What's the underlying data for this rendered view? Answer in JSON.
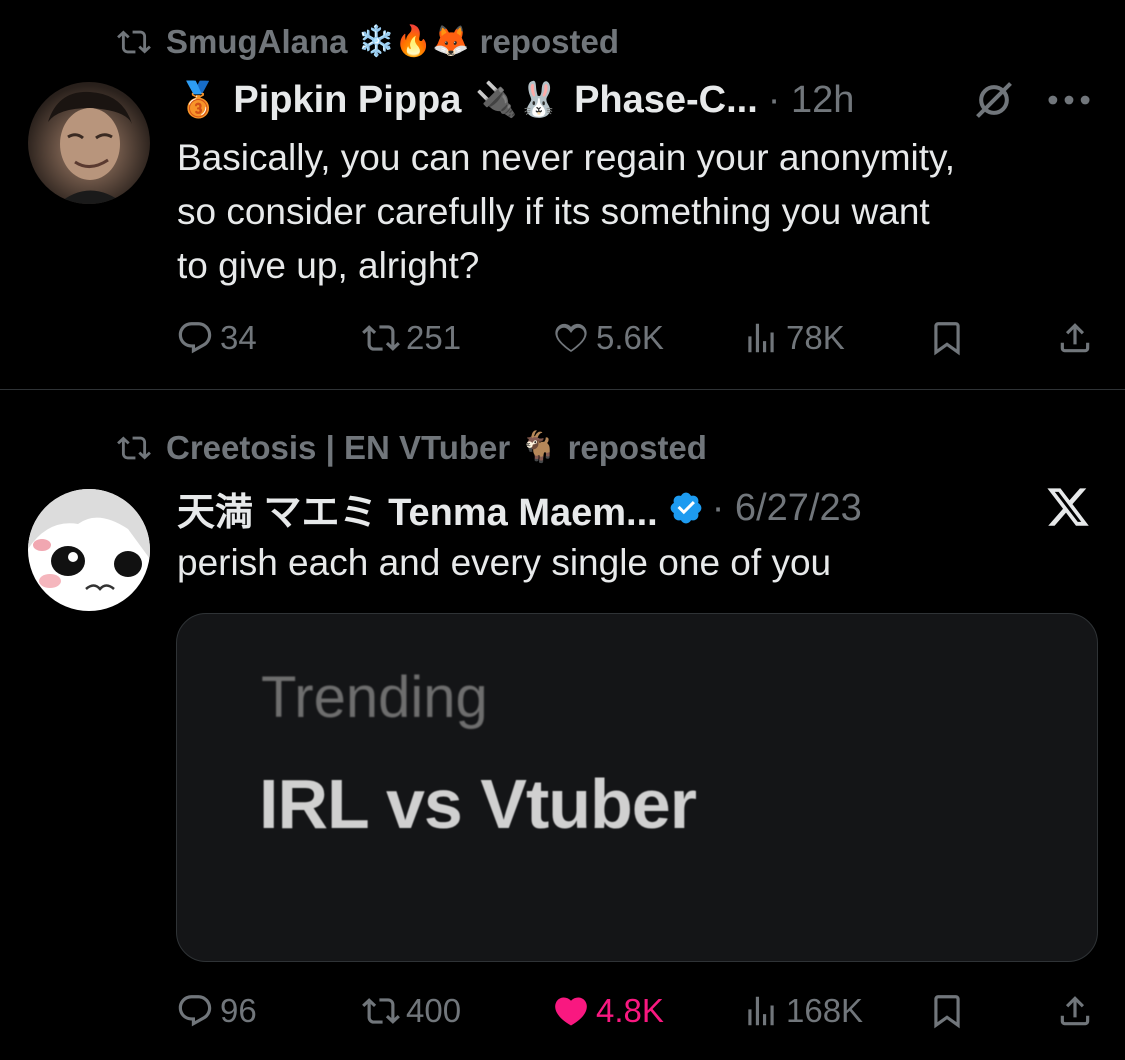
{
  "tweets": [
    {
      "repost": {
        "user": "SmugAlana",
        "emojis": "❄️🔥🦊",
        "label": "reposted"
      },
      "badge_emoji": "🥉",
      "author": "Pipkin Pippa",
      "name_emojis": "🔌🐰",
      "author_suffix": "Phase-C...",
      "time": "· 12h",
      "text_lines": [
        "Basically, you can never regain your anonymity,",
        "so consider carefully if its something you want",
        "to give up, alright?"
      ],
      "stats": {
        "replies": "34",
        "reposts": "251",
        "likes": "5.6K",
        "views": "78K"
      }
    },
    {
      "repost": {
        "user": "Creetosis | EN VTuber",
        "emojis": "🐐",
        "label": "reposted"
      },
      "author": "天満 マエミ Tenma Maem...",
      "time": "· 6/27/23",
      "text_lines": [
        "perish each and every single one of you"
      ],
      "card": {
        "small": "Trending",
        "big": "IRL vs Vtuber"
      },
      "stats": {
        "replies": "96",
        "reposts": "400",
        "likes": "4.8K",
        "views": "168K"
      }
    }
  ],
  "colors": {
    "background": "#000000",
    "text": "#e7e9ea",
    "muted": "#71767b",
    "like": "#f91880",
    "verified": "#1d9bf0"
  },
  "icons": [
    "repost-icon",
    "reply-icon",
    "like-icon",
    "views-icon",
    "bookmark-icon",
    "share-icon",
    "more-icon",
    "x-logo-icon",
    "verified-icon",
    "grok-icon"
  ]
}
